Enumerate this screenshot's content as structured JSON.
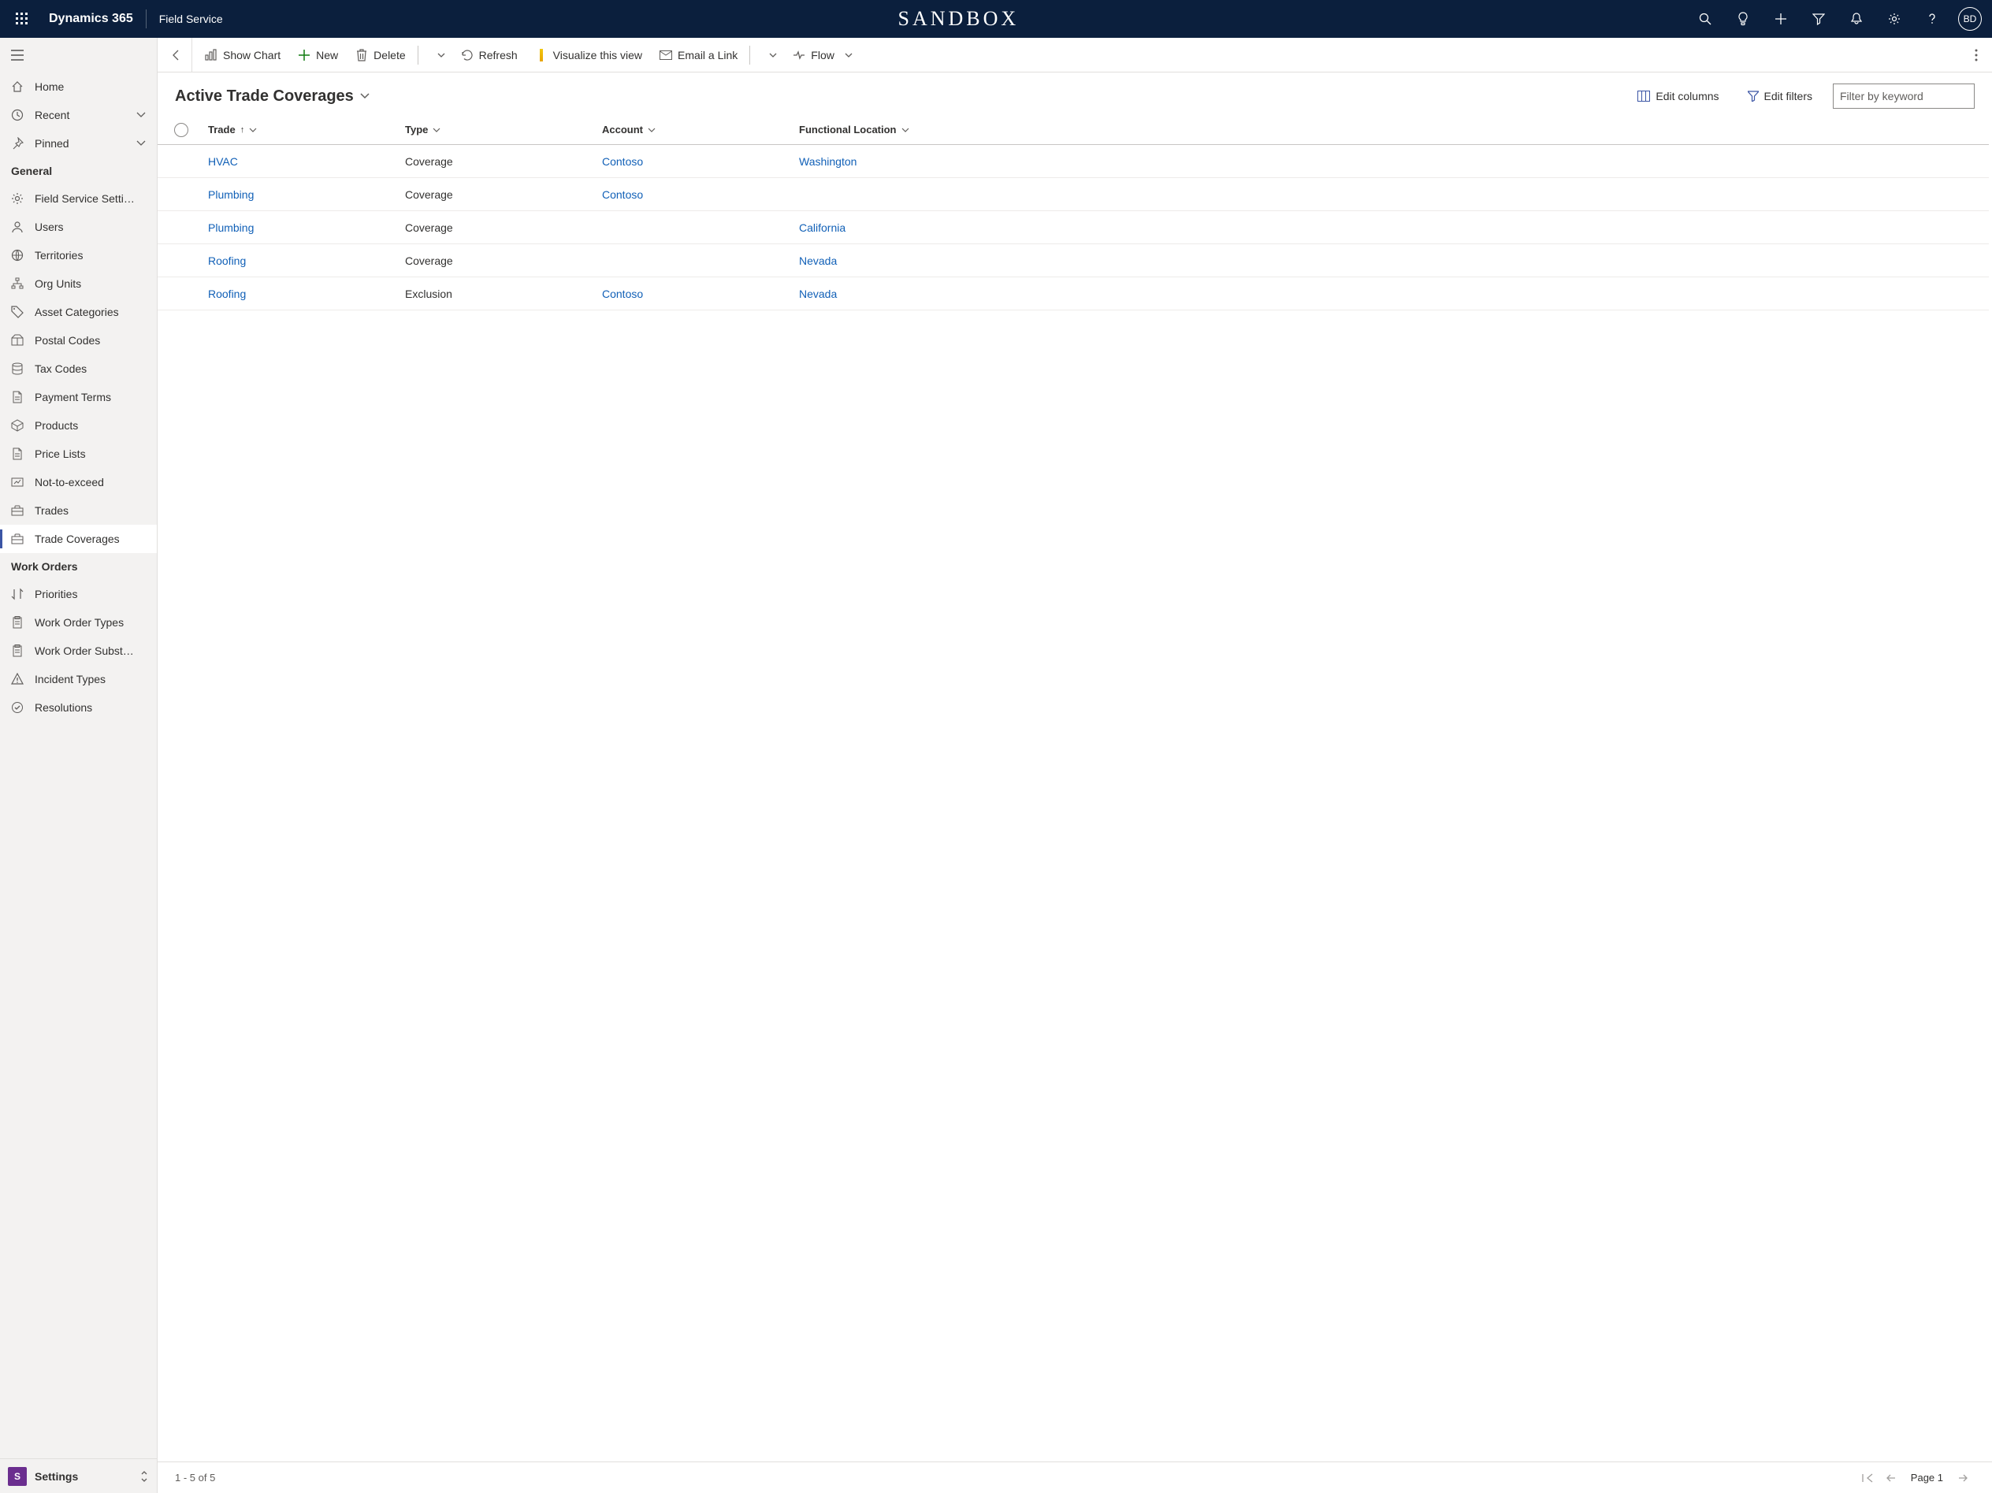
{
  "topbar": {
    "brand": "Dynamics 365",
    "app": "Field Service",
    "env": "SANDBOX",
    "avatar_initials": "BD"
  },
  "sidebar": {
    "top": [
      {
        "icon": "home",
        "label": "Home"
      },
      {
        "icon": "clock",
        "label": "Recent",
        "expandable": true
      },
      {
        "icon": "pin",
        "label": "Pinned",
        "expandable": true
      }
    ],
    "groups": [
      {
        "header": "General",
        "items": [
          {
            "icon": "gear",
            "label": "Field Service Setti…"
          },
          {
            "icon": "person",
            "label": "Users"
          },
          {
            "icon": "globe",
            "label": "Territories"
          },
          {
            "icon": "orgchart",
            "label": "Org Units"
          },
          {
            "icon": "tag",
            "label": "Asset Categories"
          },
          {
            "icon": "mailbox",
            "label": "Postal Codes"
          },
          {
            "icon": "stack",
            "label": "Tax Codes"
          },
          {
            "icon": "doc",
            "label": "Payment Terms"
          },
          {
            "icon": "box",
            "label": "Products"
          },
          {
            "icon": "doc",
            "label": "Price Lists"
          },
          {
            "icon": "limit",
            "label": "Not-to-exceed"
          },
          {
            "icon": "briefcase",
            "label": "Trades"
          },
          {
            "icon": "briefcase",
            "label": "Trade Coverages",
            "active": true
          }
        ]
      },
      {
        "header": "Work Orders",
        "items": [
          {
            "icon": "sort",
            "label": "Priorities"
          },
          {
            "icon": "clipboard",
            "label": "Work Order Types"
          },
          {
            "icon": "clipboard",
            "label": "Work Order Subst…"
          },
          {
            "icon": "warning",
            "label": "Incident Types"
          },
          {
            "icon": "check",
            "label": "Resolutions"
          }
        ]
      }
    ],
    "footer": {
      "badge": "S",
      "label": "Settings"
    }
  },
  "commands": {
    "show_chart": "Show Chart",
    "new": "New",
    "delete": "Delete",
    "refresh": "Refresh",
    "visualize": "Visualize this view",
    "email": "Email a Link",
    "flow": "Flow"
  },
  "view": {
    "title": "Active Trade Coverages",
    "edit_columns": "Edit columns",
    "edit_filters": "Edit filters",
    "filter_placeholder": "Filter by keyword"
  },
  "grid": {
    "columns": {
      "trade": "Trade",
      "type": "Type",
      "account": "Account",
      "location": "Functional Location"
    },
    "sort_column": "trade",
    "rows": [
      {
        "trade": "HVAC",
        "type": "Coverage",
        "account": "Contoso",
        "location": "Washington"
      },
      {
        "trade": "Plumbing",
        "type": "Coverage",
        "account": "Contoso",
        "location": ""
      },
      {
        "trade": "Plumbing",
        "type": "Coverage",
        "account": "",
        "location": "California"
      },
      {
        "trade": "Roofing",
        "type": "Coverage",
        "account": "",
        "location": "Nevada"
      },
      {
        "trade": "Roofing",
        "type": "Exclusion",
        "account": "Contoso",
        "location": "Nevada"
      }
    ]
  },
  "status": {
    "range": "1 - 5 of 5",
    "page": "Page 1"
  }
}
